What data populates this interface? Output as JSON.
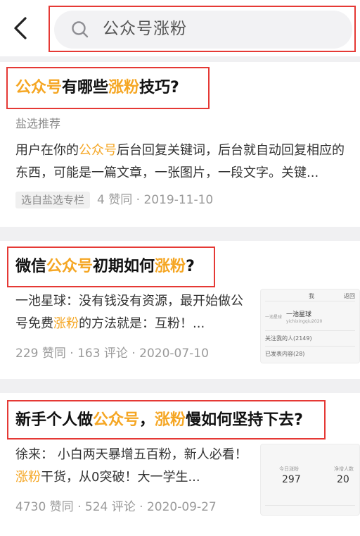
{
  "search": {
    "query": "公众号涨粉"
  },
  "results": [
    {
      "title": [
        {
          "t": "公众号",
          "hl": true
        },
        {
          "t": "有哪些",
          "hl": false
        },
        {
          "t": "涨粉",
          "hl": true
        },
        {
          "t": "技巧?",
          "hl": false
        }
      ],
      "source": "盐选推荐",
      "excerpt": [
        {
          "t": "用户在你的",
          "hl": false
        },
        {
          "t": "公众号",
          "hl": true
        },
        {
          "t": "后台回复关键词，后台就自动回复相应的东西，可能是一篇文章，一张图片，一段文字。关键...",
          "hl": false
        }
      ],
      "tag": "选自盐选专栏",
      "meta": "4 赞同 · 2019-11-10"
    },
    {
      "title": [
        {
          "t": "微信",
          "hl": false
        },
        {
          "t": "公众号",
          "hl": true
        },
        {
          "t": "初期如何",
          "hl": false
        },
        {
          "t": "涨粉",
          "hl": true
        },
        {
          "t": "?",
          "hl": false
        }
      ],
      "excerpt": [
        {
          "t": "一池星球：没有钱没有资源，最开始做公号免费",
          "hl": false
        },
        {
          "t": "涨粉",
          "hl": true
        },
        {
          "t": "的方法就是：互粉！...",
          "hl": false
        }
      ],
      "meta": "229 赞同 · 163 评论 · 2020-07-10",
      "thumb": {
        "top_right": "返回",
        "top_center": "我",
        "name": "一池星球",
        "handle": "yichixingqiu2020",
        "row1": "关注我的人(2149)",
        "row2": "已发表内容(28)"
      }
    },
    {
      "title": [
        {
          "t": "新手个人做",
          "hl": false
        },
        {
          "t": "公众号",
          "hl": true
        },
        {
          "t": "，",
          "hl": false
        },
        {
          "t": "涨粉",
          "hl": true
        },
        {
          "t": "慢如何坚持下去?",
          "hl": false
        }
      ],
      "excerpt": [
        {
          "t": "徐来： 小白两天暴增五百粉，新人必看！",
          "hl": false
        },
        {
          "t": "涨粉",
          "hl": true
        },
        {
          "t": "干货，从0突破！大一学生...",
          "hl": false
        }
      ],
      "meta": "4730 赞同 · 524 评论 · 2020-09-27",
      "thumb": {
        "label1": "今日涨粉",
        "value1": "297",
        "label2": "净增人数",
        "value2": "20"
      }
    }
  ]
}
